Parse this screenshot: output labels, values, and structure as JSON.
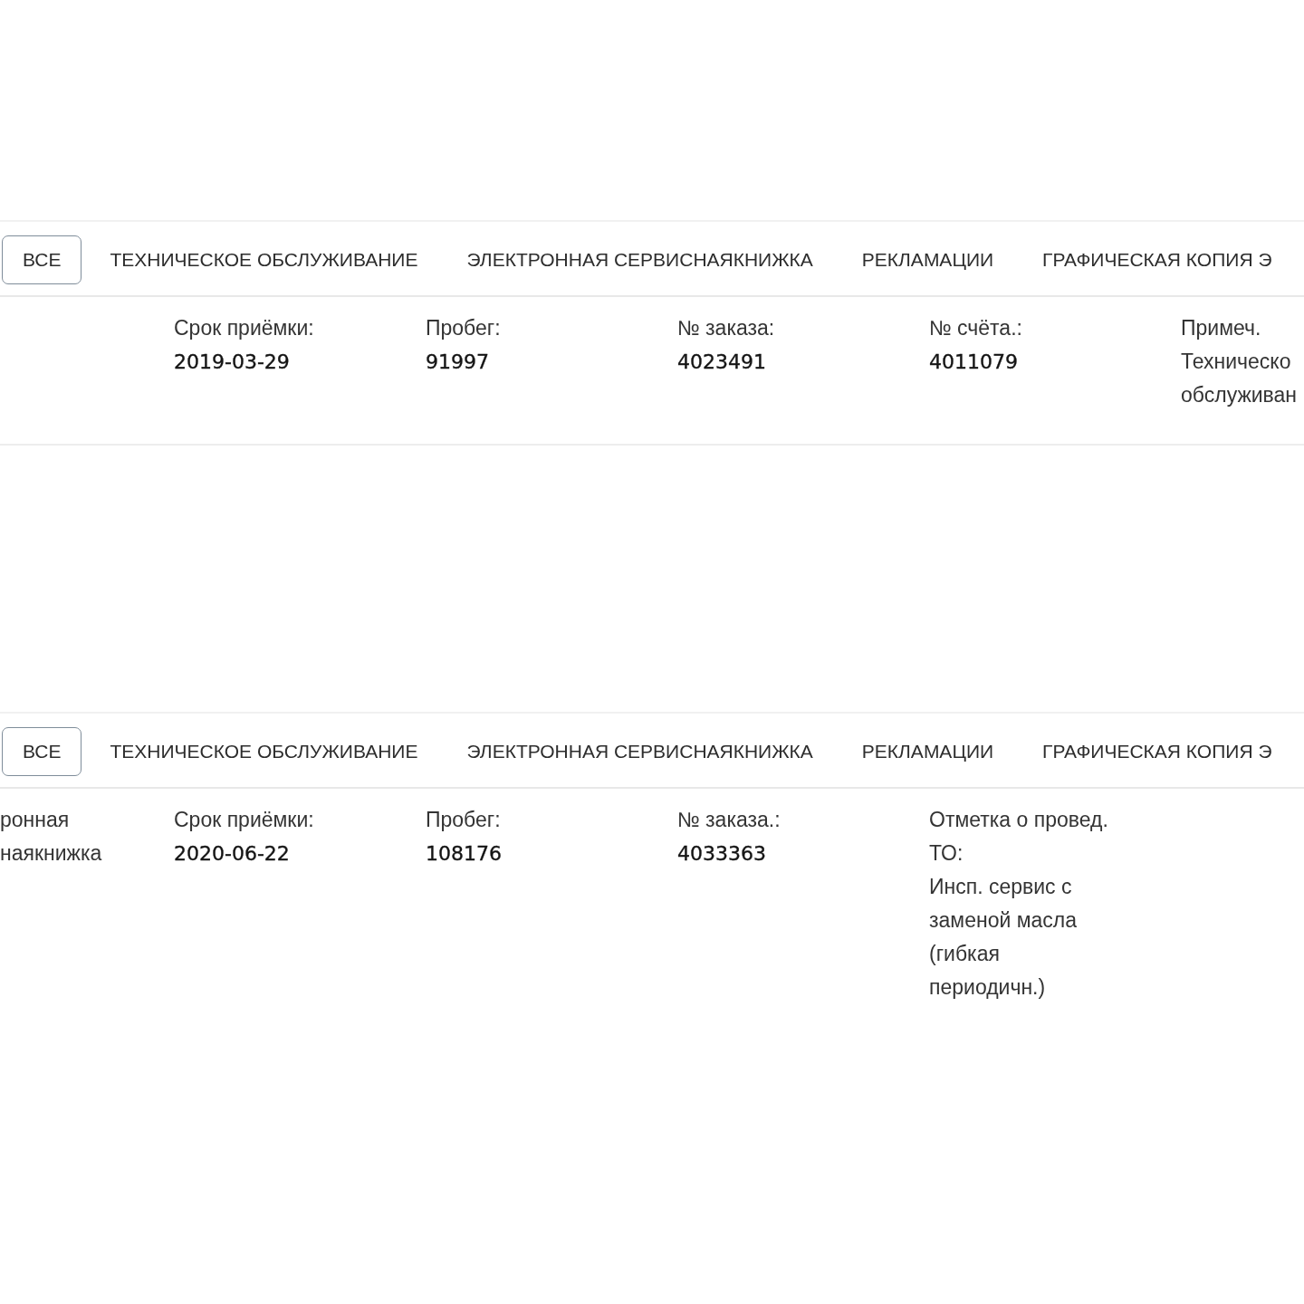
{
  "panels": [
    {
      "tabs": [
        {
          "label": "ВСЕ",
          "selected": true
        },
        {
          "label": "ТЕХНИЧЕСКОЕ ОБСЛУЖИВАНИЕ",
          "selected": false
        },
        {
          "label": "ЭЛЕКТРОННАЯ СЕРВИСНАЯКНИЖКА",
          "selected": false
        },
        {
          "label": "РЕКЛАМАЦИИ",
          "selected": false
        },
        {
          "label": "ГРАФИЧЕСКАЯ КОПИЯ Э",
          "selected": false
        }
      ],
      "record": {
        "fields": [
          {
            "kind": "value",
            "label": "Срок приёмки:",
            "value": "2019-03-29"
          },
          {
            "kind": "value",
            "label": "Пробег:",
            "value": "91997"
          },
          {
            "kind": "value",
            "label": "№ заказа:",
            "value": "4023491"
          },
          {
            "kind": "value",
            "label": "№ счёта.:",
            "value": "4011079"
          },
          {
            "kind": "note",
            "label": "Примеч.",
            "value": "Техническо обслуживан"
          }
        ]
      }
    },
    {
      "tabs": [
        {
          "label": "ВСЕ",
          "selected": true
        },
        {
          "label": "ТЕХНИЧЕСКОЕ ОБСЛУЖИВАНИЕ",
          "selected": false
        },
        {
          "label": "ЭЛЕКТРОННАЯ СЕРВИСНАЯКНИЖКА",
          "selected": false
        },
        {
          "label": "РЕКЛАМАЦИИ",
          "selected": false
        },
        {
          "label": "ГРАФИЧЕСКАЯ КОПИЯ Э",
          "selected": false
        }
      ],
      "record": {
        "category": "ронная наякнижка",
        "fields": [
          {
            "kind": "value",
            "label": "Срок приёмки:",
            "value": "2020-06-22"
          },
          {
            "kind": "value",
            "label": "Пробег:",
            "value": "108176"
          },
          {
            "kind": "value",
            "label": "№ заказа.:",
            "value": "4033363"
          },
          {
            "kind": "note",
            "label": "Отметка о провед. ТО:",
            "value": "Инсп. сервис с заменой масла (гибкая периодичн.)"
          }
        ]
      }
    }
  ]
}
